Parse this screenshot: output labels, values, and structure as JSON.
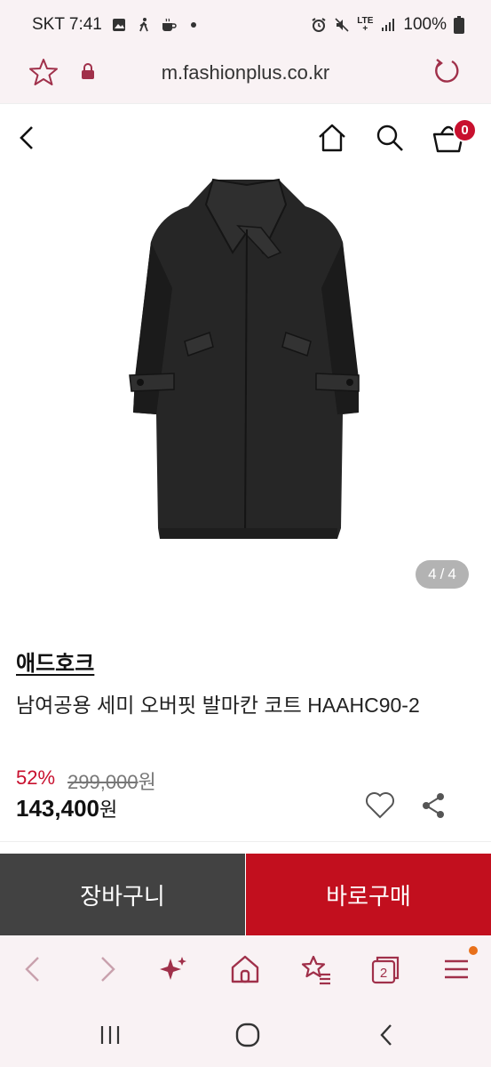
{
  "status_bar": {
    "carrier_time": "SKT 7:41",
    "lte_top": "LTE",
    "lte_bottom": "+",
    "battery": "100%"
  },
  "browser": {
    "url": "m.fashionplus.co.kr"
  },
  "header": {
    "cart_count": "0"
  },
  "gallery": {
    "current": "4",
    "separator": "/",
    "total": "4"
  },
  "product": {
    "brand": "애드호크",
    "name": "남여공용 세미 오버핏 발마칸 코트 HAAHC90-2",
    "discount": "52%",
    "original_price": "299,000",
    "original_currency": "원",
    "sale_price": "143,400",
    "sale_currency": "원"
  },
  "cta": {
    "cart_label": "장바구니",
    "buy_label": "바로구매"
  },
  "colors": {
    "accent": "#c20f1e",
    "cart_button": "#424242",
    "browser_bar": "#f9f2f4"
  },
  "icons": [
    "star-icon",
    "lock-icon",
    "reload-icon",
    "back-icon",
    "home-icon",
    "search-icon",
    "cart-icon",
    "heart-icon",
    "share-icon",
    "sparkle-icon",
    "tabs-icon",
    "menu-icon"
  ],
  "browser_toolbar": {
    "tab_count": "2"
  }
}
